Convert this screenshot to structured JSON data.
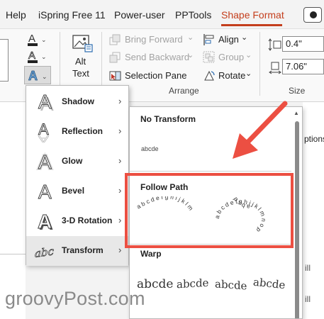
{
  "menubar": {
    "tabs": [
      {
        "label": "Help",
        "active": false
      },
      {
        "label": "iSpring Free 11",
        "active": false
      },
      {
        "label": "Power-user",
        "active": false
      },
      {
        "label": "PPTools",
        "active": false
      },
      {
        "label": "Shape Format",
        "active": true
      }
    ],
    "accent_color": "#c43e1c"
  },
  "ribbon": {
    "alt_text": {
      "line1": "Alt",
      "line2": "Text"
    },
    "arrange": {
      "bring_forward": "Bring Forward",
      "send_backward": "Send Backward",
      "selection_pane": "Selection Pane",
      "align": "Align",
      "group": "Group",
      "rotate": "Rotate",
      "group_label": "Arrange"
    },
    "size": {
      "height": "0.4\"",
      "width": "7.06\"",
      "group_label": "Size"
    }
  },
  "effects_menu": {
    "items": [
      {
        "label": "Shadow",
        "icon": "shadow-a-icon",
        "selected": false
      },
      {
        "label": "Reflection",
        "icon": "reflection-a-icon",
        "selected": false
      },
      {
        "label": "Glow",
        "icon": "glow-a-icon",
        "selected": false
      },
      {
        "label": "Bevel",
        "icon": "bevel-a-icon",
        "selected": false
      },
      {
        "label": "3-D Rotation",
        "icon": "3d-rotation-a-icon",
        "selected": false
      },
      {
        "label": "Transform",
        "icon": "transform-abc-icon",
        "selected": true
      }
    ]
  },
  "gallery": {
    "no_transform": {
      "heading": "No Transform",
      "sample": "abcde"
    },
    "follow_path": {
      "heading": "Follow Path",
      "sample": "abcdefghijklmnop"
    },
    "warp": {
      "heading": "Warp",
      "sample": "abcde"
    }
  },
  "background": {
    "right_text_1": "ptions",
    "right_text_2": "ill",
    "right_text_3": "ill"
  },
  "annotations": {
    "highlight_color": "#ec4f42"
  },
  "watermark": "groovyPost.com"
}
